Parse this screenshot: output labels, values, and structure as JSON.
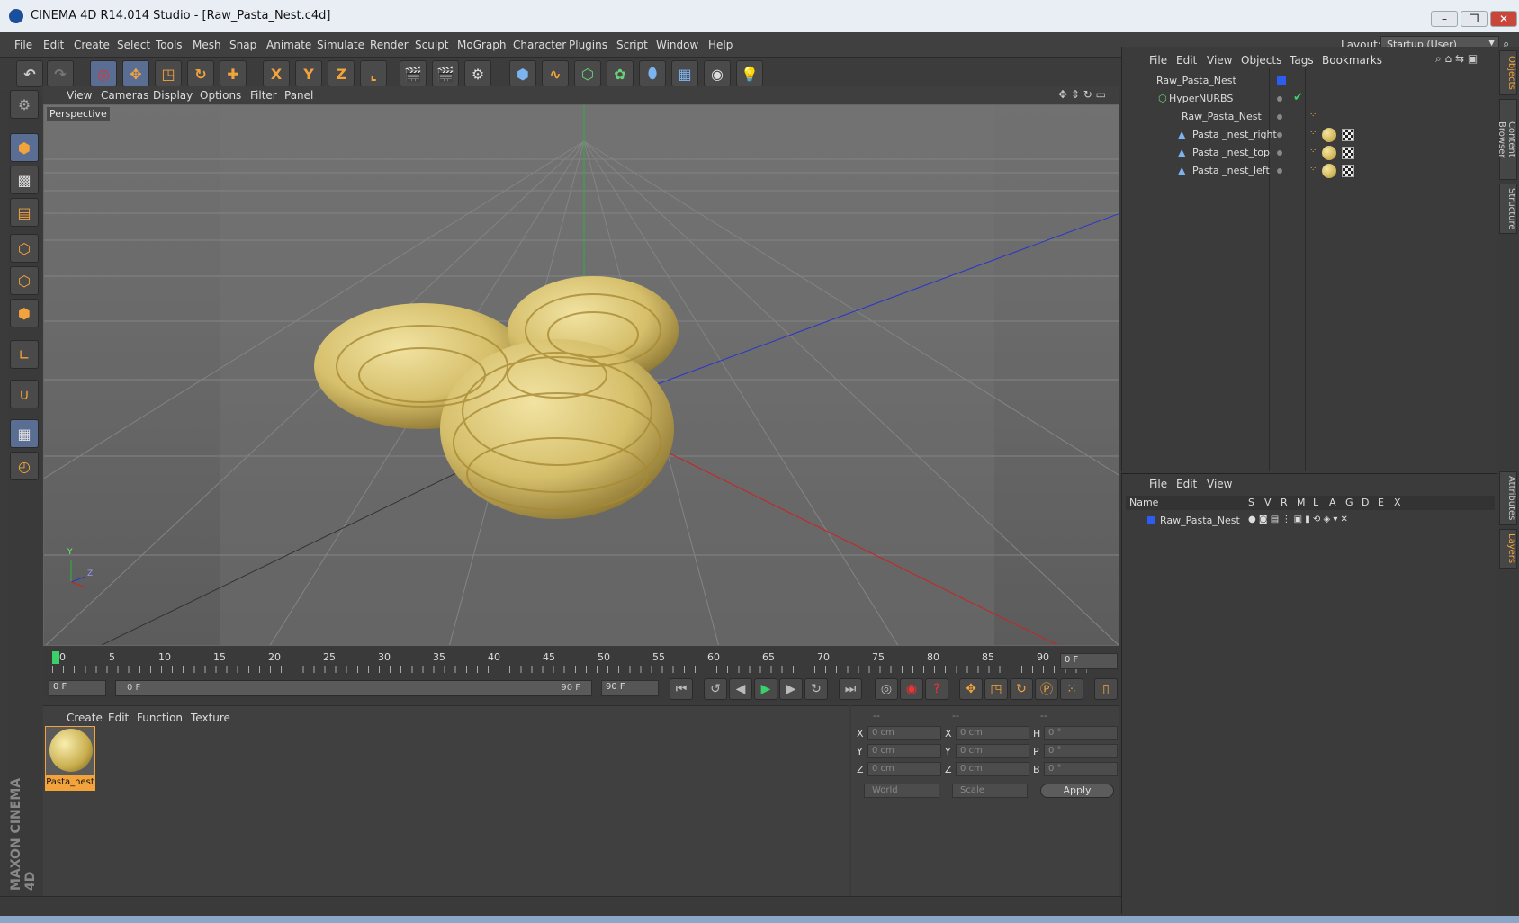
{
  "window": {
    "title": "CINEMA 4D R14.014 Studio - [Raw_Pasta_Nest.c4d]"
  },
  "menubar": {
    "items": [
      "File",
      "Edit",
      "Create",
      "Select",
      "Tools",
      "Mesh",
      "Snap",
      "Animate",
      "Simulate",
      "Render",
      "Sculpt",
      "MoGraph",
      "Character",
      "Plugins",
      "Script",
      "Window",
      "Help"
    ],
    "layout_label": "Layout:",
    "layout_value": "Startup (User)"
  },
  "toolbar": {
    "axis_x": "X",
    "axis_y": "Y",
    "axis_z": "Z"
  },
  "viewport": {
    "menu": [
      "View",
      "Cameras",
      "Display",
      "Options",
      "Filter",
      "Panel"
    ],
    "label": "Perspective",
    "axis_y": "Y",
    "axis_z": "Z"
  },
  "timeline": {
    "ticks": [
      "0",
      "5",
      "10",
      "15",
      "20",
      "25",
      "30",
      "35",
      "40",
      "45",
      "50",
      "55",
      "60",
      "65",
      "70",
      "75",
      "80",
      "85",
      "90"
    ],
    "current_frame": "0 F",
    "start_field": "0 F",
    "range_start": "0 F",
    "range_end": "90 F",
    "end_field": "90 F"
  },
  "materials": {
    "menu": [
      "Create",
      "Edit",
      "Function",
      "Texture"
    ],
    "items": [
      {
        "name": "Pasta_nest"
      }
    ]
  },
  "coordinates": {
    "header": [
      "--",
      "--",
      "--"
    ],
    "rows": [
      {
        "l1": "X",
        "v1": "0 cm",
        "l2": "X",
        "v2": "0 cm",
        "l3": "H",
        "v3": "0 °"
      },
      {
        "l1": "Y",
        "v1": "0 cm",
        "l2": "Y",
        "v2": "0 cm",
        "l3": "P",
        "v3": "0 °"
      },
      {
        "l1": "Z",
        "v1": "0 cm",
        "l2": "Z",
        "v2": "0 cm",
        "l3": "B",
        "v3": "0 °"
      }
    ],
    "mode1": "World",
    "mode2": "Scale",
    "apply": "Apply"
  },
  "objects": {
    "menu": [
      "File",
      "Edit",
      "View",
      "Objects",
      "Tags",
      "Bookmarks"
    ],
    "tree": [
      {
        "name": "Raw_Pasta_Nest",
        "indent": 0
      },
      {
        "name": "HyperNURBS",
        "indent": 1
      },
      {
        "name": "Raw_Pasta_Nest",
        "indent": 2
      },
      {
        "name": "Pasta _nest_right",
        "indent": 3
      },
      {
        "name": "Pasta _nest_top",
        "indent": 3
      },
      {
        "name": "Pasta _nest_left",
        "indent": 3
      }
    ]
  },
  "layers": {
    "menu": [
      "File",
      "Edit",
      "View"
    ],
    "columns": [
      "Name",
      "S",
      "V",
      "R",
      "M",
      "L",
      "A",
      "G",
      "D",
      "E",
      "X"
    ],
    "rows": [
      {
        "name": "Raw_Pasta_Nest"
      }
    ]
  },
  "right_tabs": [
    "Objects",
    "Content Browser",
    "Structure",
    "Attributes",
    "Layers"
  ],
  "brand": "MAXON CINEMA 4D",
  "colors": {
    "accent": "#f2a33c",
    "pasta": "#e2cf82",
    "selected": "#5a6e94"
  }
}
